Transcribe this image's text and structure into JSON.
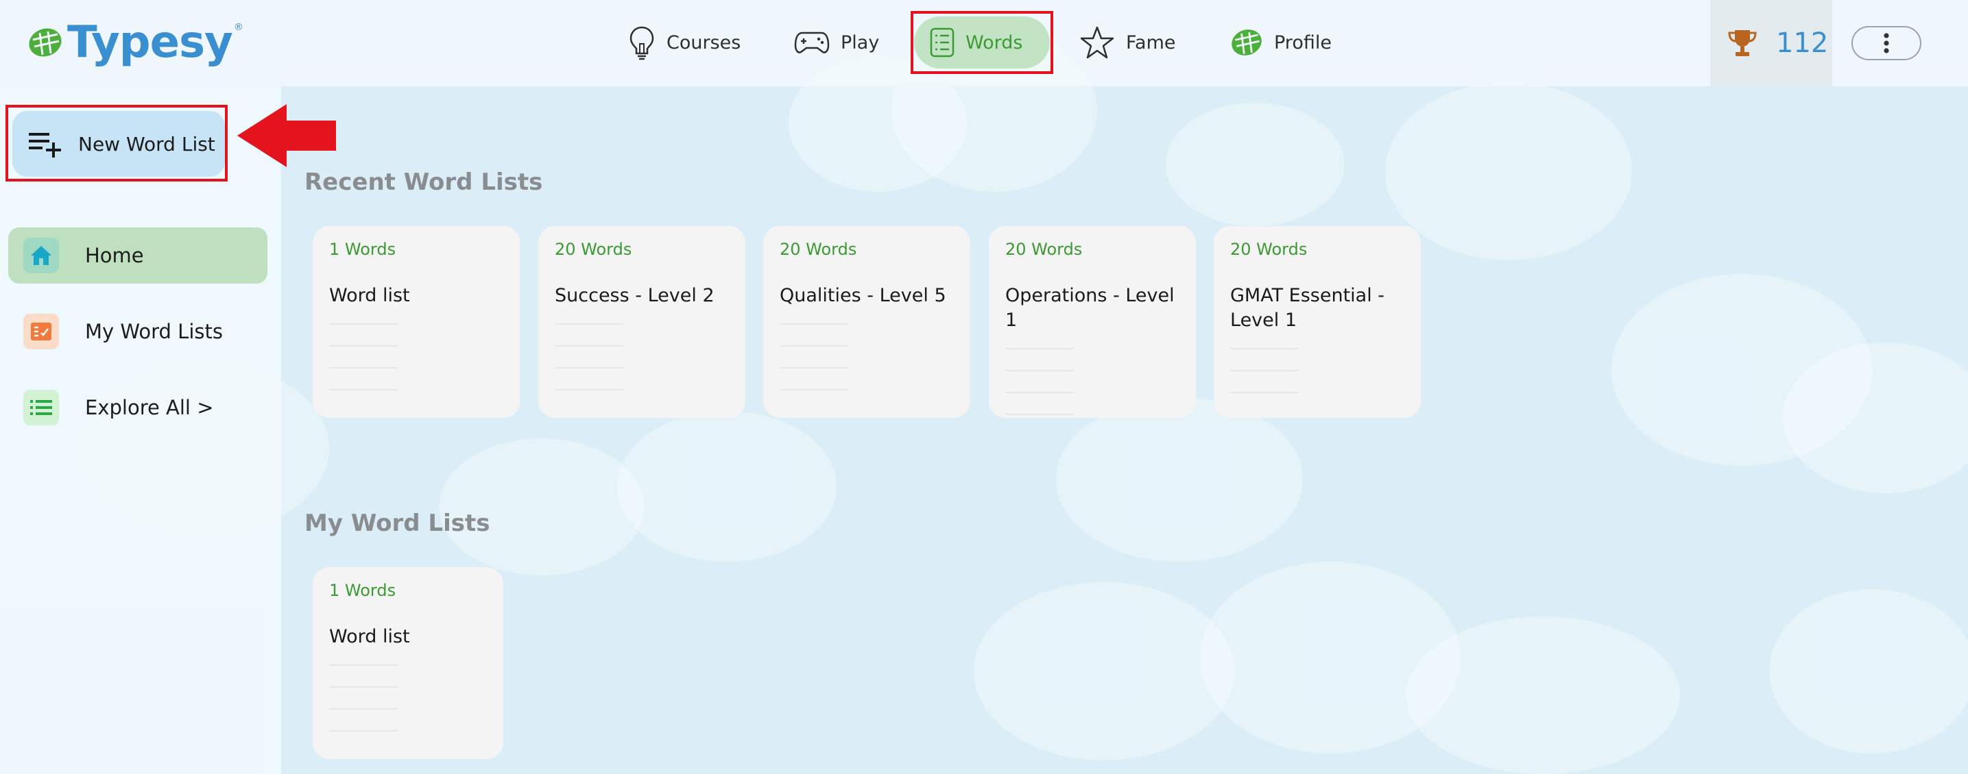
{
  "app": {
    "logo_text": "Typesy",
    "logo_reg": "®"
  },
  "nav": {
    "items": [
      {
        "label": "Courses",
        "icon": "lightbulb-icon"
      },
      {
        "label": "Play",
        "icon": "gamepad-icon"
      },
      {
        "label": "Words",
        "icon": "list-document-icon",
        "active": true
      },
      {
        "label": "Fame",
        "icon": "star-icon"
      },
      {
        "label": "Profile",
        "icon": "typesy-profile-icon"
      }
    ]
  },
  "trophy": {
    "icon": "trophy-icon",
    "count": "112"
  },
  "menu": {
    "icon": "vertical-dots-icon"
  },
  "sidebar": {
    "new_list_label": "New Word List",
    "items": [
      {
        "label": "Home",
        "icon": "home-icon",
        "active": true
      },
      {
        "label": "My Word Lists",
        "icon": "checklist-icon"
      },
      {
        "label": "Explore All >",
        "icon": "bullet-list-icon"
      }
    ]
  },
  "sections": {
    "recent": {
      "title": "Recent Word Lists",
      "cards": [
        {
          "count": "1 Words",
          "name": "Word list"
        },
        {
          "count": "20 Words",
          "name": "Success - Level 2"
        },
        {
          "count": "20 Words",
          "name": "Qualities - Level 5"
        },
        {
          "count": "20 Words",
          "name": "Operations - Level 1"
        },
        {
          "count": "20 Words",
          "name": "GMAT Essential - Level 1"
        }
      ]
    },
    "mine": {
      "title": "My Word Lists",
      "cards": [
        {
          "count": "1 Words",
          "name": "Word list"
        }
      ]
    }
  },
  "colors": {
    "accent_blue": "#3a8fd0",
    "accent_green": "#3b9a33",
    "highlight_red": "#e3141d",
    "active_green_bg": "#c3e4c4"
  }
}
